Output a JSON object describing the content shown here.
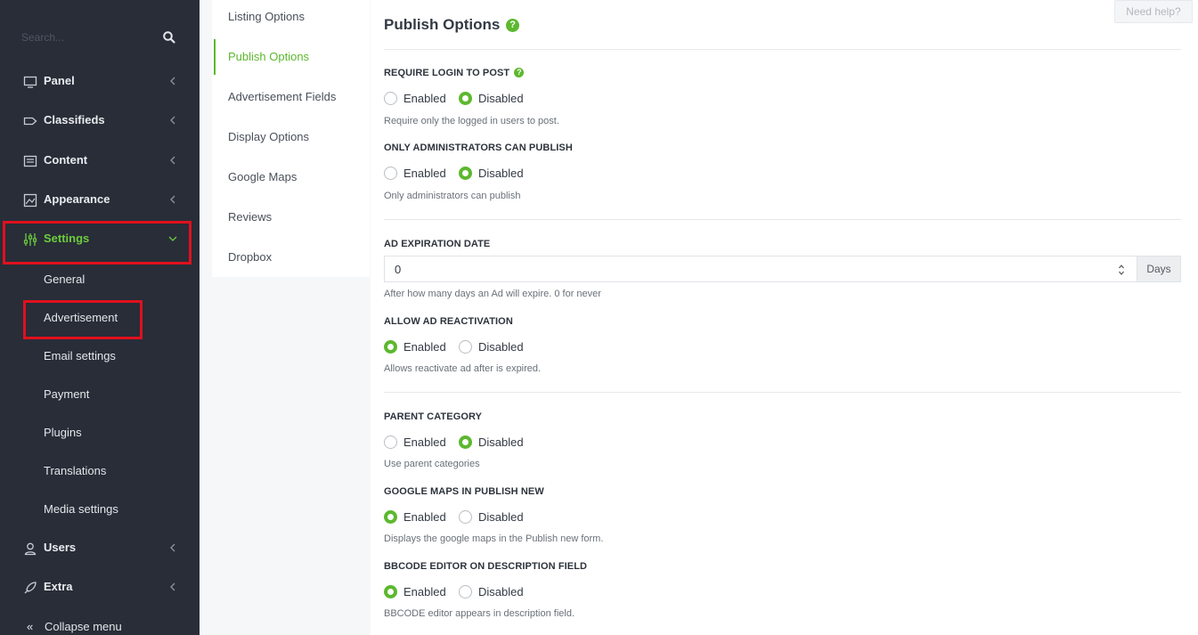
{
  "sidebar": {
    "search_placeholder": "Search...",
    "items": [
      {
        "label": "Panel"
      },
      {
        "label": "Classifieds"
      },
      {
        "label": "Content"
      },
      {
        "label": "Appearance"
      },
      {
        "label": "Settings"
      },
      {
        "label": "Users"
      },
      {
        "label": "Extra"
      }
    ],
    "settings_sub": [
      {
        "label": "General"
      },
      {
        "label": "Advertisement"
      },
      {
        "label": "Email settings"
      },
      {
        "label": "Payment"
      },
      {
        "label": "Plugins"
      },
      {
        "label": "Translations"
      },
      {
        "label": "Media settings"
      }
    ],
    "collapse_label": "Collapse menu"
  },
  "submenu": {
    "items": [
      {
        "label": "Listing Options"
      },
      {
        "label": "Publish Options"
      },
      {
        "label": "Advertisement Fields"
      },
      {
        "label": "Display Options"
      },
      {
        "label": "Google Maps"
      },
      {
        "label": "Reviews"
      },
      {
        "label": "Dropbox"
      }
    ]
  },
  "main": {
    "title": "Publish Options",
    "help_button": "Need help?",
    "help_glyph": "?",
    "enabled_label": "Enabled",
    "disabled_label": "Disabled",
    "settings": [
      {
        "label": "REQUIRE LOGIN TO POST",
        "enabled": false,
        "hint": "Require only the logged in users to post."
      },
      {
        "label": "ONLY ADMINISTRATORS CAN PUBLISH",
        "enabled": false,
        "hint": "Only administrators can publish"
      },
      {
        "label": "ALLOW AD REACTIVATION",
        "enabled": true,
        "hint": "Allows reactivate ad after is expired."
      },
      {
        "label": "PARENT CATEGORY",
        "enabled": false,
        "hint": "Use parent categories"
      },
      {
        "label": "GOOGLE MAPS IN PUBLISH NEW",
        "enabled": true,
        "hint": "Displays the google maps in the Publish new form."
      },
      {
        "label": "BBCODE EDITOR ON DESCRIPTION FIELD",
        "enabled": true,
        "hint": "BBCODE editor appears in description field."
      }
    ],
    "expiration": {
      "label": "AD EXPIRATION DATE",
      "value": "0",
      "unit": "Days",
      "hint": "After how many days an Ad will expire. 0 for never"
    }
  },
  "colors": {
    "sidebar_bg": "#282d38",
    "accent": "#5cb82e",
    "highlight_box": "#e0101d"
  }
}
